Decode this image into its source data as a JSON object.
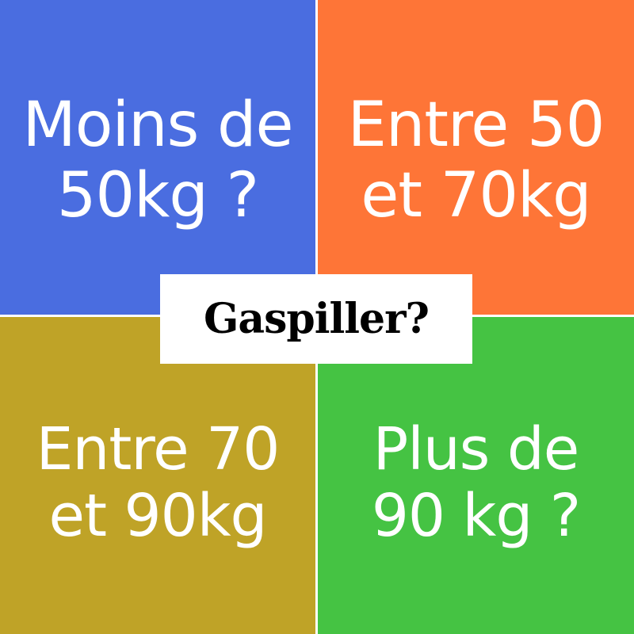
{
  "quadrants": {
    "top_left": {
      "lines": [
        "Moins de",
        "50kg ?"
      ],
      "color": "#4a6de0"
    },
    "top_right": {
      "lines": [
        "Entre 50",
        "et 70kg"
      ],
      "color": "#fe7537"
    },
    "bottom_left": {
      "lines": [
        "Entre 70",
        "et 90kg"
      ],
      "color": "#bfa327"
    },
    "bottom_right": {
      "lines": [
        "Plus de",
        "90 kg ?"
      ],
      "color": "#45c343"
    }
  },
  "center": {
    "label": "Gaspiller?"
  },
  "colors": {
    "text": "#ffffff",
    "divider": "#ffffff",
    "center_text": "#000000"
  }
}
